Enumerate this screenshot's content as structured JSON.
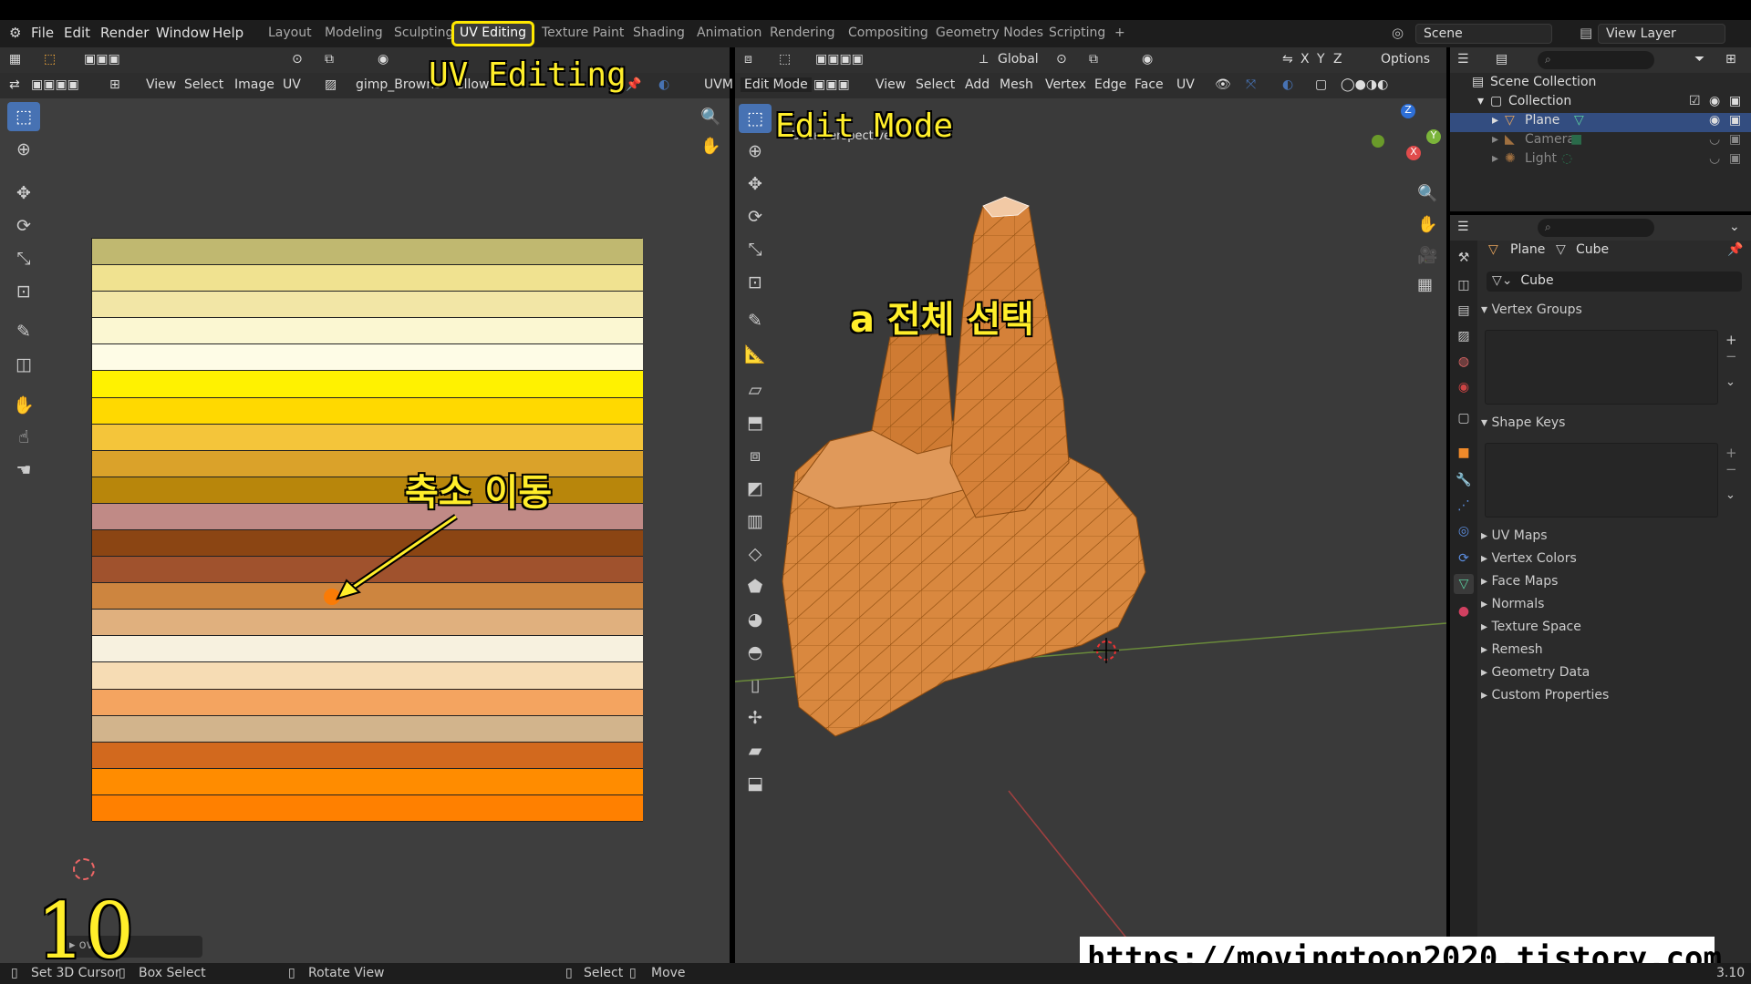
{
  "menu": {
    "file": "File",
    "edit": "Edit",
    "render": "Render",
    "window": "Window",
    "help": "Help"
  },
  "workspaces": [
    "Layout",
    "Modeling",
    "Sculpting",
    "UV Editing",
    "Texture Paint",
    "Shading",
    "Animation",
    "Rendering",
    "Compositing",
    "Geometry Nodes",
    "Scripting",
    "+"
  ],
  "scene": {
    "label": "Scene",
    "view_layer": "View Layer"
  },
  "uv_header": {
    "view": "View",
    "select": "Select",
    "image": "Image",
    "uv": "UV",
    "image_name": "gimp_Browns",
    "image_name_tail": "ellow",
    "uvmap_label": "UVM"
  },
  "view3d_header": {
    "mode": "Edit Mode",
    "view": "View",
    "select": "Select",
    "add": "Add",
    "mesh": "Mesh",
    "vertex": "Vertex",
    "edge": "Edge",
    "face": "Face",
    "uv": "UV",
    "orientation": "Global",
    "options": "Options",
    "axes": [
      "X",
      "Y",
      "Z"
    ]
  },
  "view3d": {
    "perspective": "User Perspective",
    "gizmo": {
      "z": "Z",
      "y": "Y",
      "x": "X"
    }
  },
  "overlays": {
    "uv_editing": "UV Editing",
    "edit_mode": "Edit Mode",
    "select_all": "a 전체 선택",
    "scale_move": "축소 이동",
    "step": "10",
    "url": "https://movingtoon2020.tistory.com"
  },
  "palette": [
    "#c0b870",
    "#f0e290",
    "#f2e6a6",
    "#fbf7d2",
    "#fefce6",
    "#fff200",
    "#ffd900",
    "#f4c53a",
    "#daa22a",
    "#b8860b",
    "#c08a86",
    "#8b4513",
    "#a0522d",
    "#cd853f",
    "#e0b07e",
    "#f7f1df",
    "#f6dcb4",
    "#f4a460",
    "#d2b48c",
    "#d2691e",
    "#ff8c00",
    "#ff8000"
  ],
  "outliner": {
    "scene_collection": "Scene Collection",
    "collection": "Collection",
    "items": [
      "Plane",
      "Camera",
      "Light"
    ]
  },
  "properties": {
    "object_name": "Plane",
    "mesh_name": "Cube",
    "data_field": "Cube",
    "sections": [
      "Vertex Groups",
      "Shape Keys",
      "UV Maps",
      "Vertex Colors",
      "Face Maps",
      "Normals",
      "Texture Space",
      "Remesh",
      "Geometry Data",
      "Custom Properties"
    ]
  },
  "redo_panel": {
    "label": "ove"
  },
  "statusbar": {
    "set_cursor": "Set 3D Cursor",
    "box_select": "Box Select",
    "rotate_view": "Rotate View",
    "select": "Select",
    "move": "Move",
    "version": "3.10"
  },
  "colors": {
    "accent": "#4772b3",
    "overlay_yellow": "#ffee2a",
    "mesh": "#d9883f"
  }
}
